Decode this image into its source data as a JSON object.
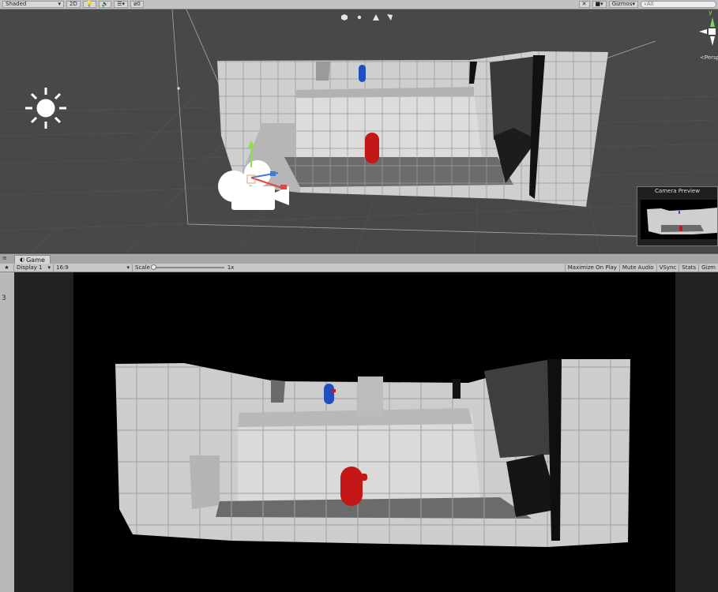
{
  "scene_toolbar": {
    "draw_mode": "Shaded",
    "two_d_label": "2D",
    "hidden_count": "0",
    "gizmos_label": "Gizmos",
    "search_placeholder": "All"
  },
  "scene_view": {
    "camera_preview_title": "Camera Preview",
    "projection_label": "Persp",
    "axis_y_label": "y"
  },
  "game_tab": {
    "label": "Game"
  },
  "game_toolbar": {
    "display": "Display 1",
    "aspect": "16:9",
    "scale_label": "Scale",
    "scale_value": "1x",
    "maximize_on_play": "Maximize On Play",
    "mute_audio": "Mute Audio",
    "vsync": "VSync",
    "stats": "Stats",
    "gizmos": "Gizm"
  },
  "colors": {
    "toolbar_bg": "#c2c2c2",
    "scene_bg": "#484848",
    "game_bg": "#000000",
    "player_red": "#c41818",
    "enemy_blue": "#1f4fbf"
  }
}
